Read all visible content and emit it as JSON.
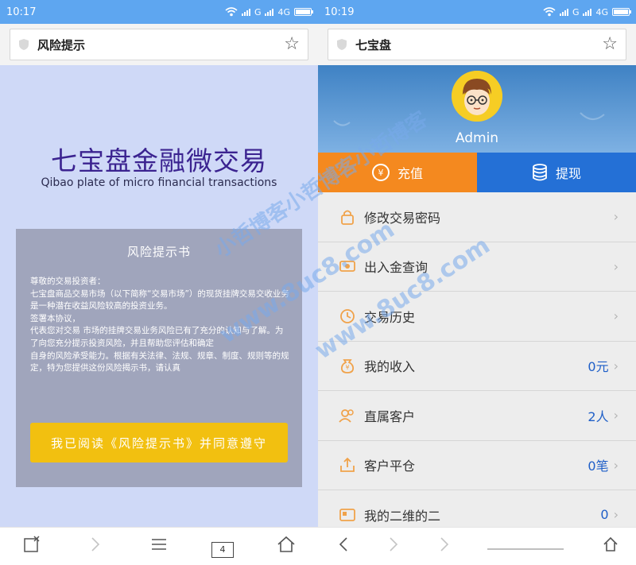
{
  "left": {
    "status": {
      "time": "10:17",
      "network1": "G",
      "network2": "4G"
    },
    "urlbar": {
      "title": "风险提示"
    },
    "brand": {
      "cn": "七宝盘金融微交易",
      "en": "Qibao plate of micro financial transactions"
    },
    "risk": {
      "title": "风险提示书",
      "paragraphs": [
        "尊敬的交易投资者：",
        "七宝盘商品交易市场（以下简称“交易市场”）的现货挂牌交易交收业务是一种潜在收益风险较高的投资业务。",
        "签署本协议，",
        "代表您对交易 市场的挂牌交易业务风险已有了充分的认知与了解。为了向您充分提示投资风险，并且帮助您评估和确定",
        "自身的风险承受能力。根据有关法律、法规、规章、制度、规则等的规定，特为您提供这份风险揭示书，请认真"
      ],
      "agree_button": "我已阅读《风险提示书》并同意遵守"
    },
    "nav": {
      "tabs_count": "4"
    }
  },
  "right": {
    "status": {
      "time": "10:19",
      "network1": "G",
      "network2": "4G"
    },
    "urlbar": {
      "title": "七宝盘"
    },
    "profile": {
      "username": "Admin"
    },
    "actions": {
      "recharge": "充值",
      "withdraw": "提现",
      "recharge_symbol": "¥"
    },
    "menu": [
      {
        "label": "修改交易密码",
        "value": "",
        "icon": "lock-icon"
      },
      {
        "label": "出入金查询",
        "value": "",
        "icon": "money-query-icon"
      },
      {
        "label": "交易历史",
        "value": "",
        "icon": "history-icon"
      },
      {
        "label": "我的收入",
        "value": "0元",
        "icon": "income-bag-icon"
      },
      {
        "label": "直属客户",
        "value": "2人",
        "icon": "customers-icon"
      },
      {
        "label": "客户平仓",
        "value": "0笔",
        "icon": "close-position-icon"
      },
      {
        "label": "我的二维的二",
        "value": "0",
        "icon": "qr-card-icon"
      }
    ]
  },
  "watermark": {
    "line1": "小哲博客小哲博客小哲博客",
    "line2": "www.8uc8.com",
    "line3": "www.8uc8.com"
  },
  "colors": {
    "accent_blue": "#2470d6",
    "accent_orange": "#f4891f",
    "button_yellow": "#f2c010",
    "value_blue": "#1f5fc8"
  }
}
